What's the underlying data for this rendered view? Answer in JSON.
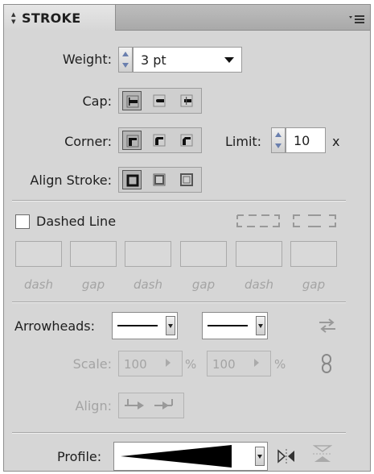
{
  "panel": {
    "title": "STROKE",
    "tab_icon": "double-arrow-icon",
    "menu_icon": "panel-menu-icon"
  },
  "weight": {
    "label": "Weight:",
    "value": "3 pt"
  },
  "cap": {
    "label": "Cap:",
    "buttons": [
      "butt-cap-icon",
      "round-cap-icon",
      "projecting-cap-icon"
    ],
    "selected": 0
  },
  "corner": {
    "label": "Corner:",
    "buttons": [
      "miter-join-icon",
      "round-join-icon",
      "bevel-join-icon"
    ],
    "selected": 0
  },
  "limit": {
    "label": "Limit:",
    "value": "10",
    "unit": "x"
  },
  "align_stroke": {
    "label": "Align Stroke:",
    "buttons": [
      "align-center-icon",
      "align-inside-icon",
      "align-outside-icon"
    ],
    "selected": 0
  },
  "dashed": {
    "label": "Dashed Line",
    "checked": false,
    "dash_gap_labels": [
      "dash",
      "gap",
      "dash",
      "gap",
      "dash",
      "gap"
    ]
  },
  "arrowheads": {
    "label": "Arrowheads:",
    "swap_icon": "swap-arrows-icon"
  },
  "scale": {
    "label": "Scale:",
    "start": "100",
    "end": "100",
    "unit": "%",
    "link_icon": "link-icon"
  },
  "align": {
    "label": "Align:"
  },
  "profile": {
    "label": "Profile:",
    "flip_icon": "flip-horizontal-icon",
    "flip_v_icon": "flip-vertical-icon"
  },
  "colors": {
    "panel_bg": "#d6d6d6",
    "accent": "#6a7fae"
  }
}
